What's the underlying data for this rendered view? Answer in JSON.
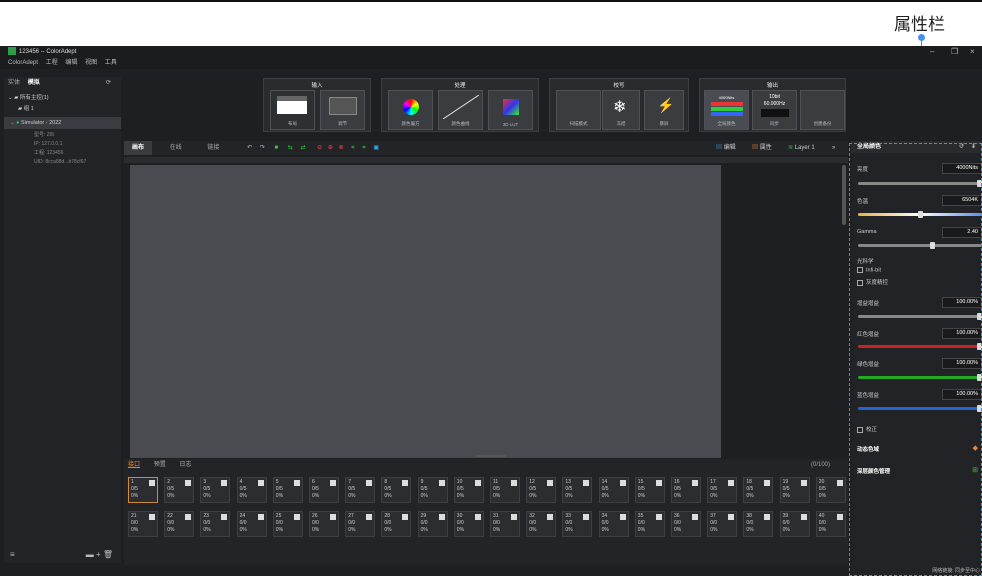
{
  "annotation": {
    "label": "属性栏"
  },
  "window": {
    "title": "123456 -- ColorAdept"
  },
  "menu": [
    "ColorAdept",
    "工程",
    "编辑",
    "视图",
    "工具"
  ],
  "left": {
    "tabs": [
      "实体",
      "模拟"
    ],
    "tree": {
      "root": "所有主控(1)",
      "group": "组 1",
      "device": "Simulator - 2022",
      "props": [
        "型号: Z8i",
        "IP: 127.0.0.1",
        "工程: 123456",
        "UID: 8cca88d...b78cf67"
      ]
    }
  },
  "pipeline": {
    "stages": [
      {
        "title": "输入",
        "tiles": [
          "布局",
          "调节"
        ]
      },
      {
        "title": "处理",
        "tiles": [
          "颜色偏方",
          "颜色曲线",
          "3D LUT"
        ]
      },
      {
        "title": "校写",
        "tiles": [
          "扫描模式",
          "冻结",
          "暴屏"
        ]
      },
      {
        "title": "输出",
        "tiles": [
          "全局颜色",
          "同步",
          "创建备份"
        ]
      }
    ],
    "output_tile": {
      "nits": "4000Nits",
      "bit": "10bit",
      "freq": "60.000Hz"
    }
  },
  "toolbar": {
    "tabs": [
      "画布",
      "在线",
      "链接"
    ],
    "right": [
      "编辑",
      "属性",
      "Layer 1"
    ]
  },
  "bottom": {
    "tabs": [
      "接口",
      "预置",
      "日志"
    ],
    "count": "(0/100)",
    "cells": [
      {
        "n": "1",
        "a": "0/5",
        "b": "0%"
      },
      {
        "n": "2",
        "a": "0/5",
        "b": "0%"
      },
      {
        "n": "3",
        "a": "0/5",
        "b": "0%"
      },
      {
        "n": "4",
        "a": "0/5",
        "b": "0%"
      },
      {
        "n": "5",
        "a": "0/5",
        "b": "0%"
      },
      {
        "n": "6",
        "a": "0/5",
        "b": "0%"
      },
      {
        "n": "7",
        "a": "0/5",
        "b": "0%"
      },
      {
        "n": "8",
        "a": "0/5",
        "b": "0%"
      },
      {
        "n": "9",
        "a": "0/5",
        "b": "0%"
      },
      {
        "n": "10",
        "a": "0/5",
        "b": "0%"
      },
      {
        "n": "11",
        "a": "0/5",
        "b": "0%"
      },
      {
        "n": "12",
        "a": "0/5",
        "b": "0%"
      },
      {
        "n": "13",
        "a": "0/5",
        "b": "0%"
      },
      {
        "n": "14",
        "a": "0/5",
        "b": "0%"
      },
      {
        "n": "15",
        "a": "0/5",
        "b": "0%"
      },
      {
        "n": "16",
        "a": "0/5",
        "b": "0%"
      },
      {
        "n": "17",
        "a": "0/5",
        "b": "0%"
      },
      {
        "n": "18",
        "a": "0/5",
        "b": "0%"
      },
      {
        "n": "19",
        "a": "0/5",
        "b": "0%"
      },
      {
        "n": "20",
        "a": "0/5",
        "b": "0%"
      },
      {
        "n": "21",
        "a": "0/0",
        "b": "0%"
      },
      {
        "n": "22",
        "a": "0/0",
        "b": "0%"
      },
      {
        "n": "23",
        "a": "0/0",
        "b": "0%"
      },
      {
        "n": "24",
        "a": "0/0",
        "b": "0%"
      },
      {
        "n": "25",
        "a": "0/0",
        "b": "0%"
      },
      {
        "n": "26",
        "a": "0/0",
        "b": "0%"
      },
      {
        "n": "27",
        "a": "0/0",
        "b": "0%"
      },
      {
        "n": "28",
        "a": "0/0",
        "b": "0%"
      },
      {
        "n": "29",
        "a": "0/0",
        "b": "0%"
      },
      {
        "n": "30",
        "a": "0/0",
        "b": "0%"
      },
      {
        "n": "31",
        "a": "0/0",
        "b": "0%"
      },
      {
        "n": "32",
        "a": "0/0",
        "b": "0%"
      },
      {
        "n": "33",
        "a": "0/0",
        "b": "0%"
      },
      {
        "n": "34",
        "a": "0/0",
        "b": "0%"
      },
      {
        "n": "35",
        "a": "0/0",
        "b": "0%"
      },
      {
        "n": "36",
        "a": "0/0",
        "b": "0%"
      },
      {
        "n": "37",
        "a": "0/0",
        "b": "0%"
      },
      {
        "n": "38",
        "a": "0/0",
        "b": "0%"
      },
      {
        "n": "39",
        "a": "0/0",
        "b": "0%"
      },
      {
        "n": "40",
        "a": "0/0",
        "b": "0%"
      }
    ]
  },
  "properties": {
    "title": "全局颜色",
    "brightness": {
      "label": "亮度",
      "value": "4000Nits"
    },
    "temp": {
      "label": "色温",
      "value": "6504K"
    },
    "gamma": {
      "label": "Gamma",
      "value": "2.40"
    },
    "light_section": "光科学",
    "infi_bit": "Infi-bit",
    "gray_fine": "灰度精控",
    "gain": {
      "label": "增益增益",
      "value": "100.00%"
    },
    "red": {
      "label": "红色增益",
      "value": "100.00%"
    },
    "green": {
      "label": "绿色增益",
      "value": "100.00%"
    },
    "blue": {
      "label": "蓝色增益",
      "value": "100.00%"
    },
    "correct": "校正",
    "dynamic": "动态色域",
    "deep": "深层颜色管理",
    "status": "网络链接: 同步至中心"
  }
}
